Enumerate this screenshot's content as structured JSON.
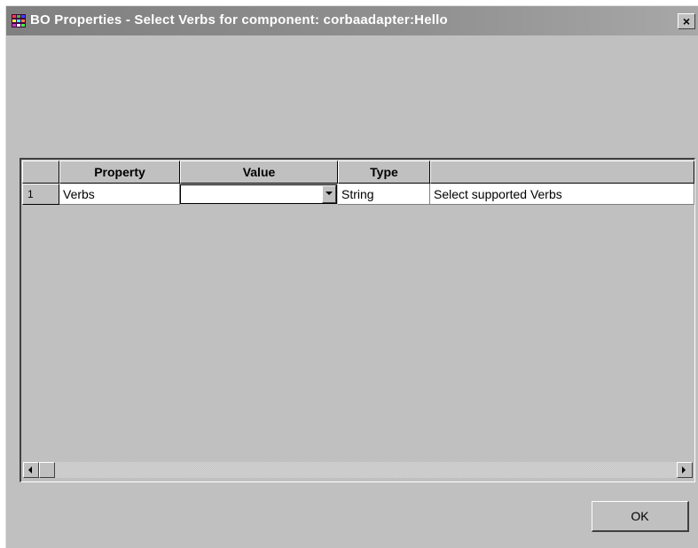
{
  "window": {
    "title": "BO Properties - Select Verbs for component: corbaadapter:Hello",
    "close_label": "×"
  },
  "grid": {
    "columns": [
      "",
      "Property",
      "Value",
      "Type",
      ""
    ],
    "rows": [
      {
        "row_number": "1",
        "property": "Verbs",
        "value": "",
        "type": "String",
        "description": "Select supported Verbs"
      }
    ]
  },
  "buttons": {
    "ok_label": "OK"
  },
  "icons": {
    "title": "app-grid-icon",
    "dropdown": "dropdown-arrow-icon",
    "scroll_left": "scroll-left-arrow-icon",
    "scroll_right": "scroll-right-arrow-icon"
  },
  "colors": {
    "titlebar": "#808080",
    "dialog_background": "#c0c0c0",
    "cell_background": "#ffffff"
  }
}
